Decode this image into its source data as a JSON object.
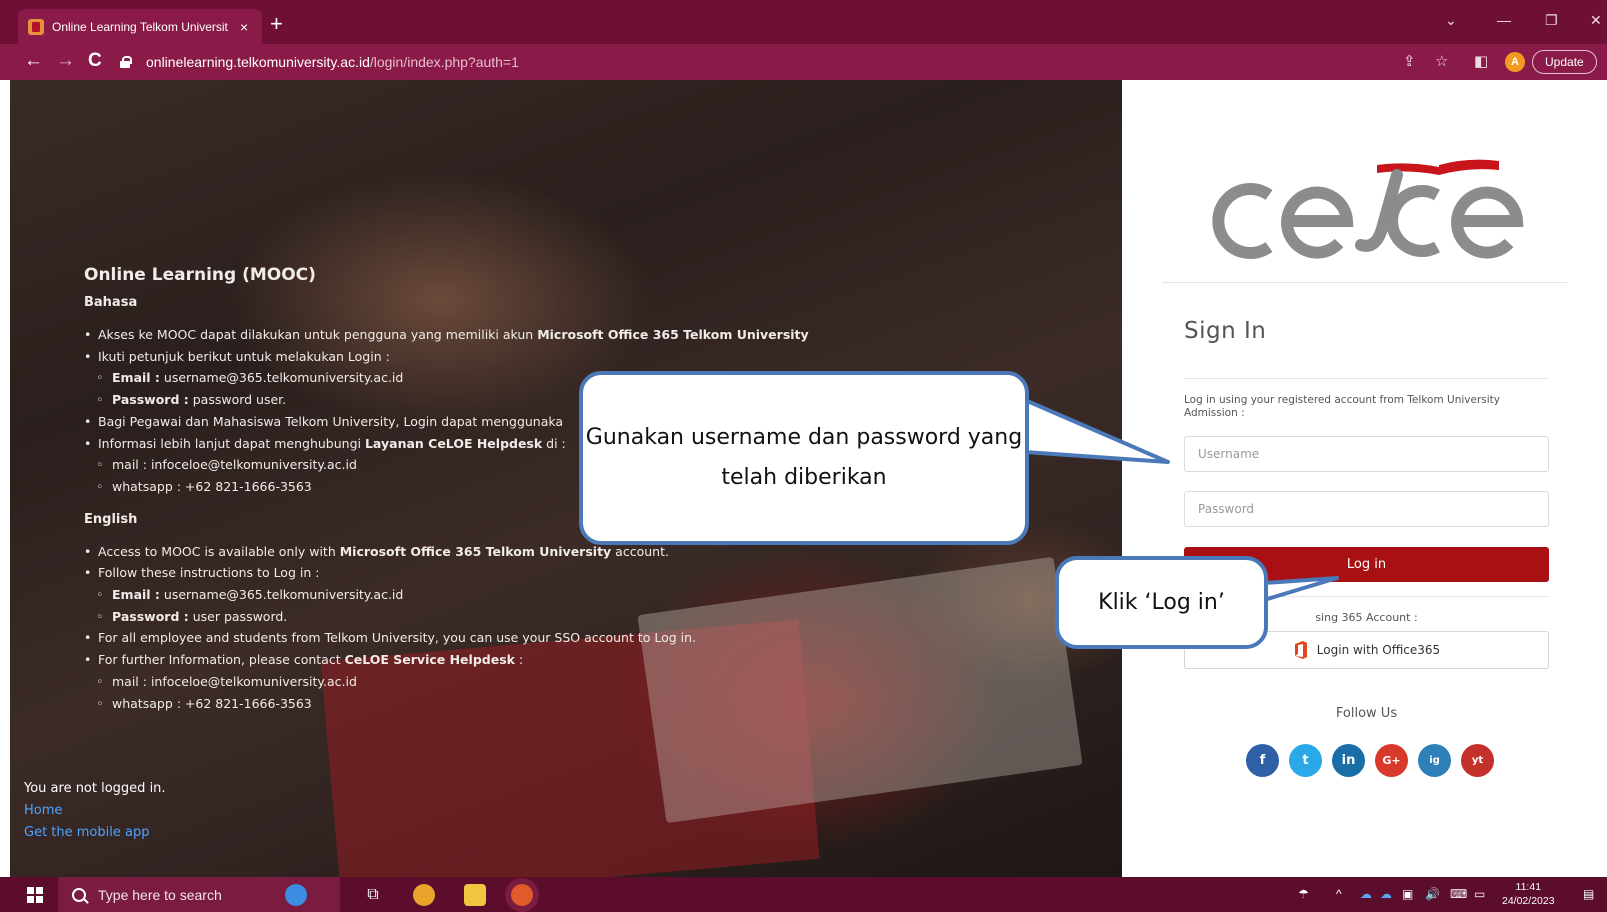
{
  "browser": {
    "tab_title": "Online Learning Telkom Universit",
    "tab_close": "×",
    "new_tab": "+",
    "url_host": "onlinelearning.telkomuniversity.ac.id",
    "url_path": "/login/index.php?auth=1",
    "profile_initial": "A",
    "update_label": "Update"
  },
  "left": {
    "heading": "Online Learning (MOOC)",
    "bahasa_title": "Bahasa",
    "bahasa": {
      "item1_pre": "Akses ke MOOC dapat dilakukan untuk pengguna yang memiliki akun ",
      "item1_bold": "Microsoft Office 365 Telkom University",
      "item2": "Ikuti petunjuk berikut untuk melakukan Login :",
      "email_label": "Email :",
      "email_value": " username@365.telkomuniversity.ac.id",
      "password_label": "Password :",
      "password_value": " password user.",
      "item3": "Bagi Pegawai dan Mahasiswa Telkom University, Login dapat menggunaka",
      "item4_pre": "Informasi lebih lanjut dapat menghubungi ",
      "item4_bold": "Layanan CeLOE Helpdesk",
      "item4_post": " di :",
      "mail": "mail : infoceloe@telkomuniversity.ac.id",
      "whatsapp": "whatsapp : +62 821-1666-3563"
    },
    "english_title": "English",
    "english": {
      "item1_pre": "Access to MOOC is available only with ",
      "item1_bold": "Microsoft Office 365 Telkom University",
      "item1_post": " account.",
      "item2": "Follow these instructions to Log in :",
      "email_label": "Email :",
      "email_value": " username@365.telkomuniversity.ac.id",
      "password_label": "Password :",
      "password_value": " user password.",
      "item3": "For all employee and students from Telkom University, you can use your SSO account to Log in.",
      "item4_pre": "For further Information, please contact ",
      "item4_bold": "CeLOE Service Helpdesk",
      "item4_post": " :",
      "mail": "mail : infoceloe@telkomuniversity.ac.id",
      "whatsapp": "whatsapp : +62 821-1666-3563"
    },
    "footer": {
      "not_logged": "You are not logged in.",
      "home": "Home",
      "mobile_app": "Get the mobile app"
    }
  },
  "signin": {
    "logo_alt": "celoe",
    "title": "Sign In",
    "description": "Log in using your registered account from Telkom University Admission :",
    "username_placeholder": "Username",
    "password_placeholder": "Password",
    "login_label": "Log in",
    "or_text": "sing 365 Account :",
    "office_label": "Login with Office365",
    "follow": "Follow Us",
    "socials": [
      "f",
      "t",
      "in",
      "G+",
      "ig",
      "yt"
    ]
  },
  "callouts": {
    "first": "Gunakan username dan password yang telah diberikan",
    "second": "Klik ‘Log in’"
  },
  "taskbar": {
    "search_placeholder": "Type here to search",
    "time": "11:41",
    "date": "24/02/2023"
  },
  "colors": {
    "chrome": "#8a1a48",
    "login_button": "#a81014",
    "callout_border": "#4a78b8",
    "link": "#4da3ff"
  }
}
